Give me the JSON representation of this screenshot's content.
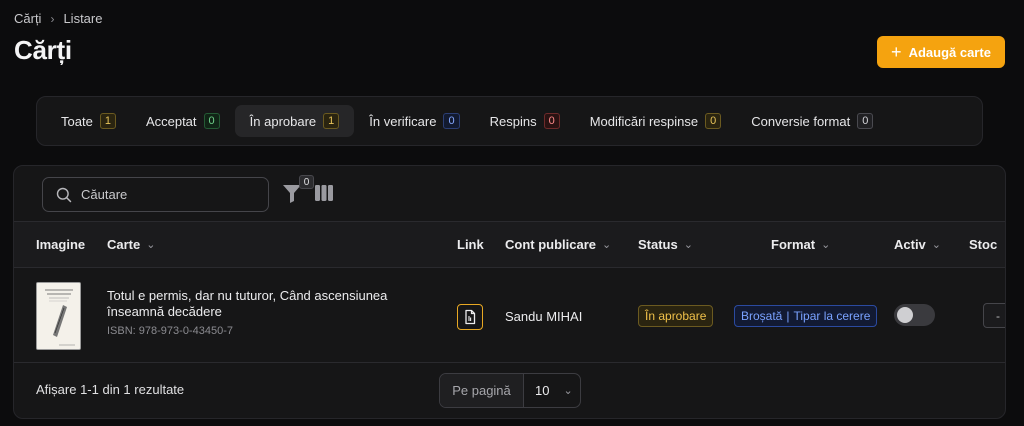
{
  "breadcrumb": {
    "root": "Cărți",
    "current": "Listare"
  },
  "page_title": "Cărți",
  "add_button": "Adaugă carte",
  "tabs": [
    {
      "label": "Toate",
      "count": "1",
      "color": "yellow"
    },
    {
      "label": "Acceptat",
      "count": "0",
      "color": "green"
    },
    {
      "label": "În aprobare",
      "count": "1",
      "color": "yellow",
      "active": true
    },
    {
      "label": "În verificare",
      "count": "0",
      "color": "blue"
    },
    {
      "label": "Respins",
      "count": "0",
      "color": "red"
    },
    {
      "label": "Modificări respinse",
      "count": "0",
      "color": "yellow"
    },
    {
      "label": "Conversie format",
      "count": "0",
      "color": "gray"
    }
  ],
  "search": {
    "placeholder": "Căutare"
  },
  "filter_count": "0",
  "columns": {
    "image": "Imagine",
    "book": "Carte",
    "link": "Link",
    "account": "Cont publicare",
    "status": "Status",
    "format": "Format",
    "active": "Activ",
    "stock": "Stoc"
  },
  "rows": [
    {
      "title": "Totul e permis, dar nu tuturor, Când ascensiunea înseamnă decădere",
      "isbn": "ISBN: 978-973-0-43450-7",
      "account": "Sandu MIHAI",
      "status": "În aprobare",
      "format_type": "Broșată",
      "format_sep": "|",
      "format_mode": "Tipar la cerere",
      "active": false,
      "stock": "-"
    }
  ],
  "footer": {
    "results": "Afișare 1-1 din 1 rezultate",
    "per_page_label": "Pe pagină",
    "per_page_value": "10"
  },
  "colors": {
    "accent": "#f5a30f",
    "background": "#0c0c0d",
    "panel": "#161617"
  }
}
